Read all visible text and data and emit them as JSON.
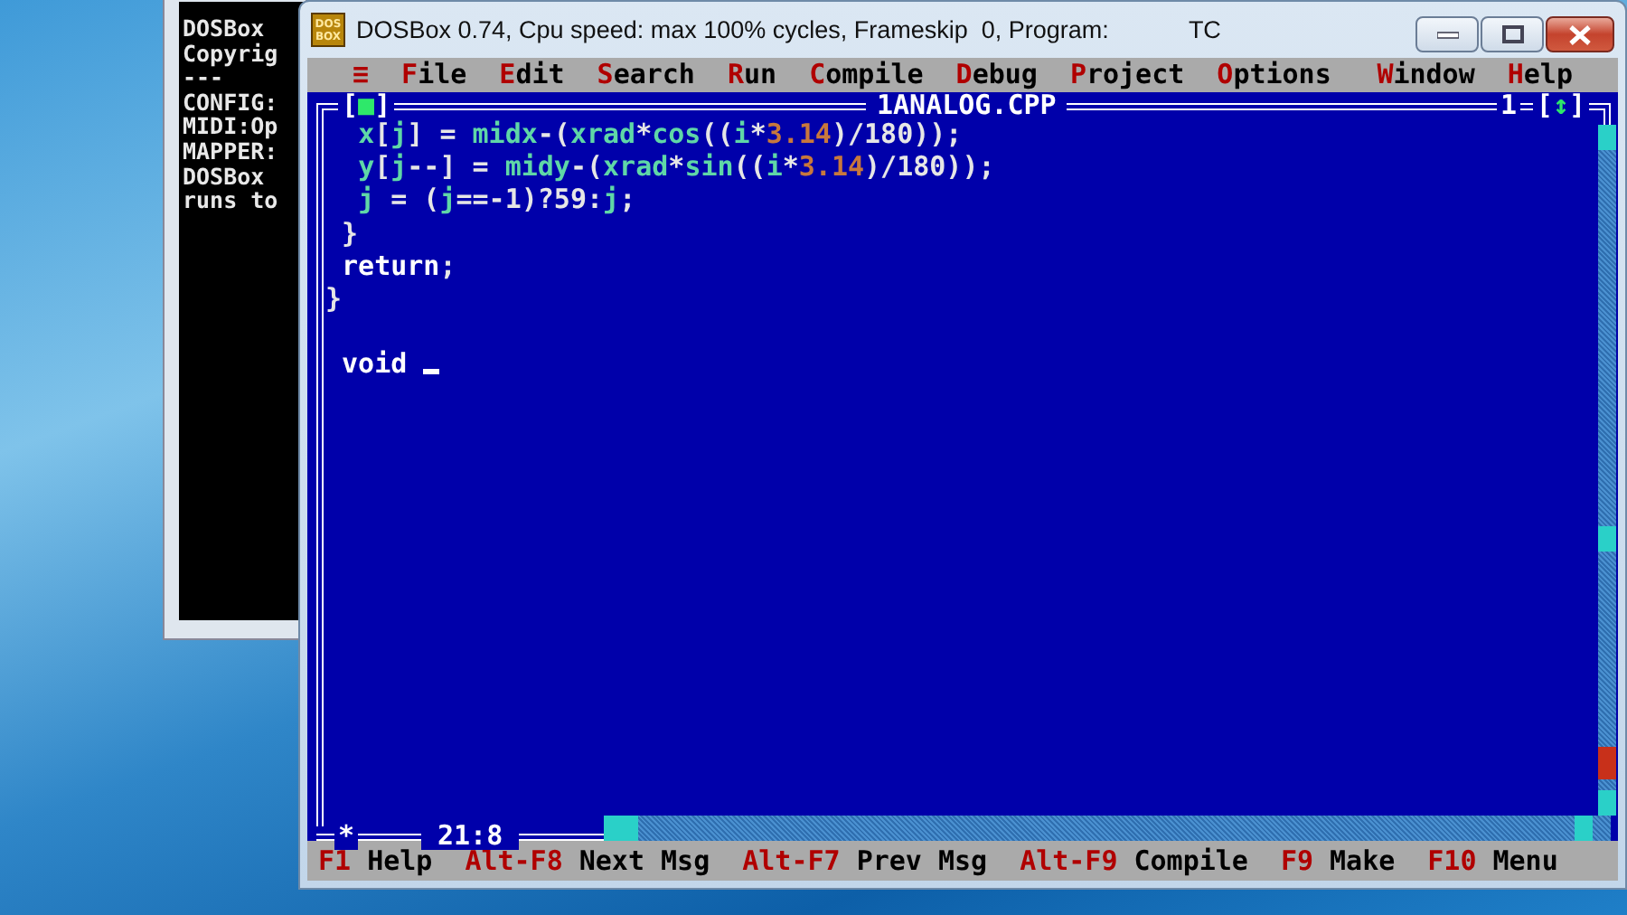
{
  "console_window": {
    "lines": [
      "DOSBox",
      "Copyrig",
      "---",
      "CONFIG:",
      "MIDI:Op",
      "MAPPER:",
      "DOSBox",
      "runs to"
    ]
  },
  "dosbox_window": {
    "logo": [
      "DOS",
      "BOX"
    ],
    "title": "DOSBox 0.74, Cpu speed: max 100% cycles, Frameskip  0, Program:",
    "program": "TC"
  },
  "menu": [
    {
      "label": "≡",
      "kind": "main"
    },
    {
      "label": "File",
      "kind": "main"
    },
    {
      "label": "Edit",
      "kind": "main"
    },
    {
      "label": "Search",
      "kind": "main"
    },
    {
      "label": "Run",
      "kind": "main"
    },
    {
      "label": "Compile",
      "kind": "main"
    },
    {
      "label": "Debug",
      "kind": "main"
    },
    {
      "label": "Project",
      "kind": "main"
    },
    {
      "label": "Options",
      "kind": "main"
    },
    {
      "label": "Window",
      "kind": "trailing"
    },
    {
      "label": "Help",
      "kind": "trailing"
    }
  ],
  "editor": {
    "title": "1ANALOG.CPP",
    "close_box": "[■]",
    "window_number": "1",
    "zoom_box": "[↕]",
    "modified_mark": "*",
    "position": "21:8",
    "lines": [
      {
        "kind": "statement",
        "gap": false,
        "cursor": false,
        "text": "  x[j] = midx-(xrad*cos((i*3.14)/180));"
      },
      {
        "kind": "statement",
        "gap": false,
        "cursor": false,
        "text": "  y[j--] = midy-(xrad*sin((i*3.14)/180));"
      },
      {
        "kind": "statement",
        "gap": false,
        "cursor": false,
        "text": "  j = (j==-1)?59:j;"
      },
      {
        "kind": "statement",
        "gap": false,
        "cursor": false,
        "text": " }"
      },
      {
        "kind": "keyword",
        "gap": false,
        "cursor": false,
        "text": " return;"
      },
      {
        "kind": "statement",
        "gap": false,
        "cursor": false,
        "text": "}"
      },
      {
        "kind": "keyword",
        "gap": true,
        "cursor": true,
        "text": " void"
      }
    ]
  },
  "status_bar": [
    {
      "key": "F1",
      "label": "Help"
    },
    {
      "key": "Alt-F8",
      "label": "Next Msg"
    },
    {
      "key": "Alt-F7",
      "label": "Prev Msg"
    },
    {
      "key": "Alt-F9",
      "label": "Compile"
    },
    {
      "key": "F9",
      "label": "Make"
    },
    {
      "key": "F10",
      "label": "Menu"
    }
  ]
}
